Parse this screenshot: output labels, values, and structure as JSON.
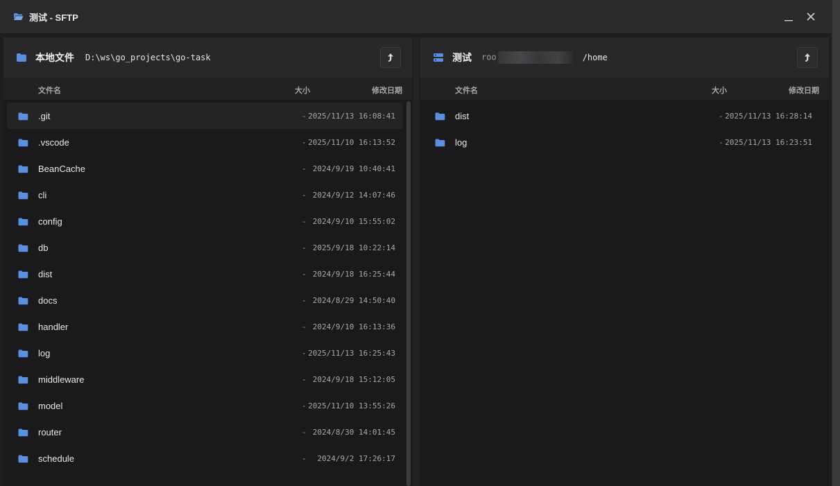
{
  "window": {
    "title": "测试 - SFTP",
    "minimize_label": "—",
    "close_label": "✕"
  },
  "local": {
    "title": "本地文件",
    "path": "D:\\ws\\go_projects\\go-task",
    "up_label": "⮥",
    "columns": {
      "name": "文件名",
      "size": "大小",
      "date": "修改日期"
    },
    "files": [
      {
        "name": ".git",
        "size": "-",
        "date": "2025/11/13 16:08:41"
      },
      {
        "name": ".vscode",
        "size": "-",
        "date": "2025/11/10 16:13:52"
      },
      {
        "name": "BeanCache",
        "size": "-",
        "date": "2024/9/19 10:40:41"
      },
      {
        "name": "cli",
        "size": "-",
        "date": "2024/9/12 14:07:46"
      },
      {
        "name": "config",
        "size": "-",
        "date": "2024/9/10 15:55:02"
      },
      {
        "name": "db",
        "size": "-",
        "date": "2025/9/18 10:22:14"
      },
      {
        "name": "dist",
        "size": "-",
        "date": "2024/9/18 16:25:44"
      },
      {
        "name": "docs",
        "size": "-",
        "date": "2024/8/29 14:50:40"
      },
      {
        "name": "handler",
        "size": "-",
        "date": "2024/9/10 16:13:36"
      },
      {
        "name": "log",
        "size": "-",
        "date": "2025/11/13 16:25:43"
      },
      {
        "name": "middleware",
        "size": "-",
        "date": "2024/9/18 15:12:05"
      },
      {
        "name": "model",
        "size": "-",
        "date": "2025/11/10 13:55:26"
      },
      {
        "name": "router",
        "size": "-",
        "date": "2024/8/30 14:01:45"
      },
      {
        "name": "schedule",
        "size": "-",
        "date": "2024/9/2 17:26:17"
      }
    ]
  },
  "remote": {
    "title": "测试",
    "host_prefix": "roo",
    "path": "/home",
    "up_label": "⮥",
    "columns": {
      "name": "文件名",
      "size": "大小",
      "date": "修改日期"
    },
    "files": [
      {
        "name": "dist",
        "size": "-",
        "date": "2025/11/13 16:28:14"
      },
      {
        "name": "log",
        "size": "-",
        "date": "2025/11/13 16:23:51"
      }
    ]
  },
  "colors": {
    "folder_icon": "#5b8fe0",
    "background": "#1a1a1c",
    "header": "#28282b"
  },
  "icons": {
    "folder": "folder-icon",
    "open_folder": "folder-open-icon",
    "server": "server-icon",
    "up": "up-arrow-icon"
  }
}
